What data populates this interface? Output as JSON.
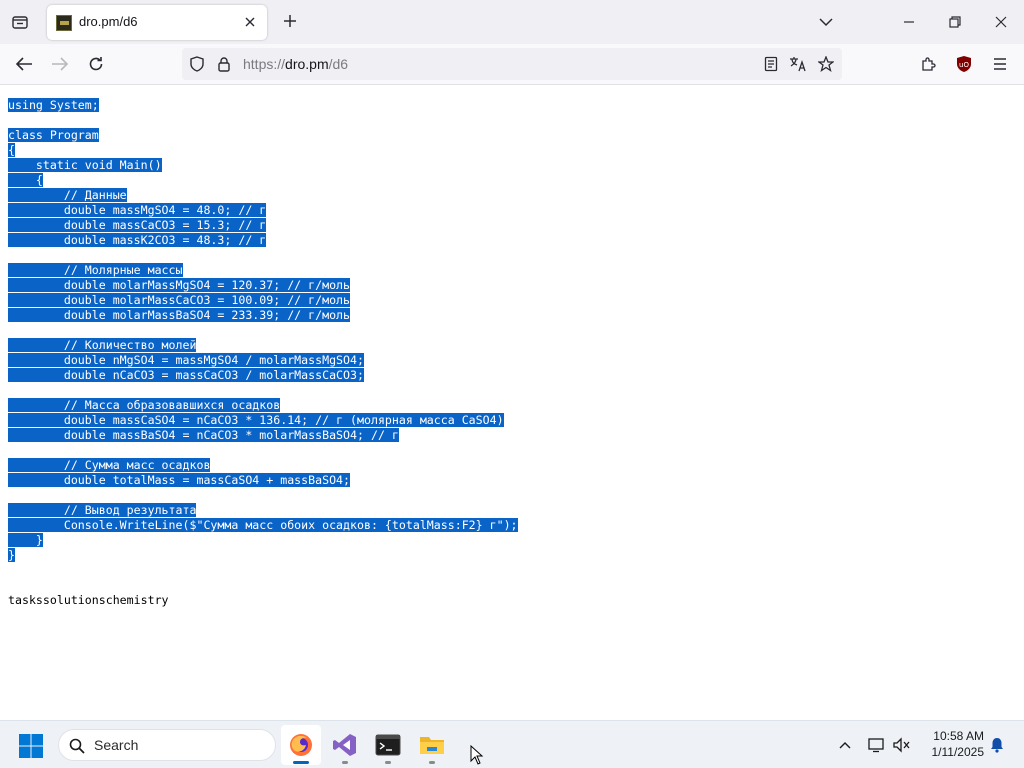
{
  "browser": {
    "tab": {
      "title": "dro.pm/d6"
    },
    "url": {
      "scheme": "https://",
      "host": "dro.pm",
      "path": "/d6"
    }
  },
  "page": {
    "code_lines": [
      "using System;",
      "",
      "class Program",
      "{",
      "    static void Main()",
      "    {",
      "        // Данные",
      "        double massMgSO4 = 48.0; // г",
      "        double massCaCO3 = 15.3; // г",
      "        double massK2CO3 = 48.3; // г",
      "",
      "        // Молярные массы",
      "        double molarMassMgSO4 = 120.37; // г/моль",
      "        double molarMassCaCO3 = 100.09; // г/моль",
      "        double molarMassBaSO4 = 233.39; // г/моль",
      "",
      "        // Количество молей",
      "        double nMgSO4 = massMgSO4 / molarMassMgSO4;",
      "        double nCaCO3 = massCaCO3 / molarMassCaCO3;",
      "",
      "        // Масса образовавшихся осадков",
      "        double massCaSO4 = nCaCO3 * 136.14; // г (молярная масса CaSO4)",
      "        double massBaSO4 = nCaCO3 * molarMassBaSO4; // г",
      "",
      "        // Сумма масс осадков",
      "        double totalMass = massCaSO4 + massBaSO4;",
      "",
      "        // Вывод результата",
      "        Console.WriteLine($\"Сумма масс обоих осадков: {totalMass:F2} г\");",
      "    }",
      "}"
    ],
    "footer_text": "taskssolutionschemistry"
  },
  "taskbar": {
    "search_placeholder": "Search",
    "clock": {
      "time": "10:58 AM",
      "date": "1/11/2025"
    }
  },
  "colors": {
    "selection": "#0a64c8",
    "accent": "#0067c0"
  }
}
